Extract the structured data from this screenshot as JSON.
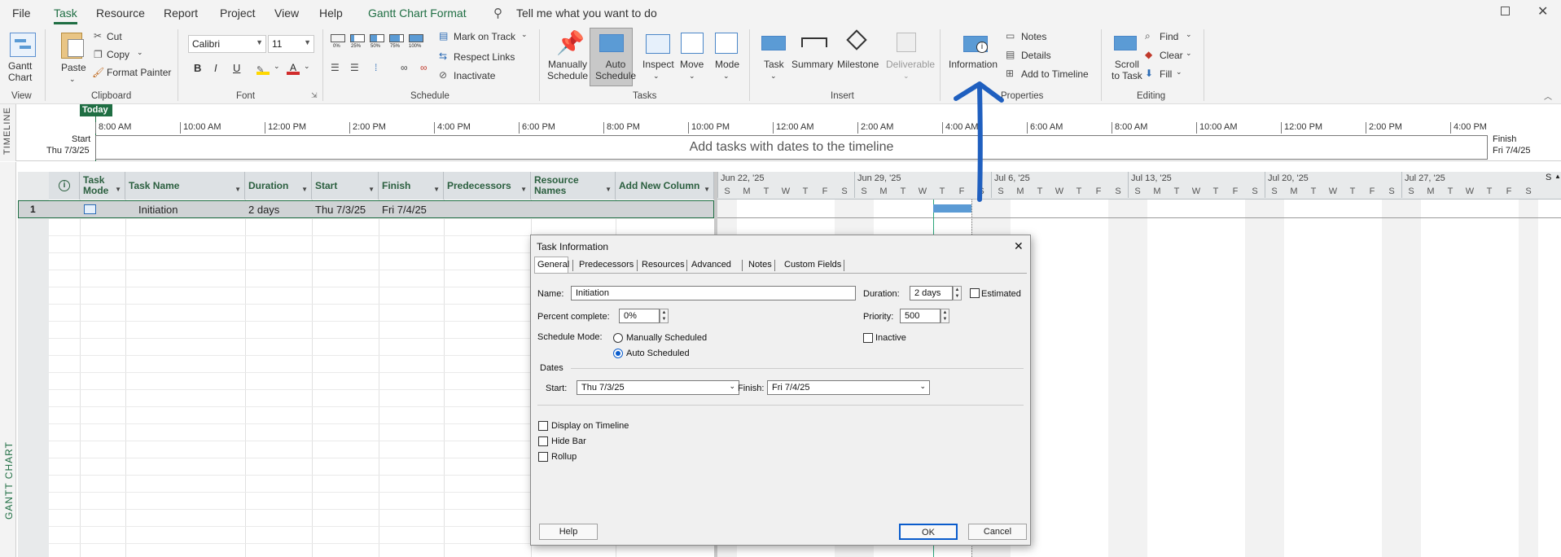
{
  "menu": {
    "file": "File",
    "task": "Task",
    "resource": "Resource",
    "report": "Report",
    "project": "Project",
    "view": "View",
    "help": "Help",
    "format": "Gantt Chart Format",
    "tell": "Tell me what you want to do"
  },
  "ribbon": {
    "gantt_chart": "Gantt\nChart",
    "groups": {
      "view": "View",
      "clipboard": "Clipboard",
      "font": "Font",
      "schedule": "Schedule",
      "tasks": "Tasks",
      "insert": "Insert",
      "properties": "Properties",
      "editing": "Editing"
    },
    "paste": "Paste",
    "cut": "Cut",
    "copy": "Copy",
    "format_painter": "Format Painter",
    "font_name": "Calibri",
    "font_size": "11",
    "bold": "B",
    "italic": "I",
    "underline": "U",
    "pct": [
      "0%",
      "25%",
      "50%",
      "75%",
      "100%"
    ],
    "mark_on_track": "Mark on Track",
    "respect_links": "Respect Links",
    "inactivate": "Inactivate",
    "manually_schedule": "Manually\nSchedule",
    "auto_schedule": "Auto\nSchedule",
    "inspect": "Inspect",
    "move": "Move",
    "mode": "Mode",
    "task": "Task",
    "summary": "Summary",
    "milestone": "Milestone",
    "deliverable": "Deliverable",
    "information": "Information",
    "notes": "Notes",
    "details": "Details",
    "add_to_timeline": "Add to Timeline",
    "scroll_to_task": "Scroll\nto Task",
    "find": "Find",
    "clear": "Clear",
    "fill": "Fill"
  },
  "timeline": {
    "side": "TIMELINE",
    "today": "Today",
    "start_label": "Start",
    "start_date": "Thu 7/3/25",
    "finish_label": "Finish",
    "finish_date": "Fri 7/4/25",
    "placeholder": "Add tasks with dates to the timeline",
    "ticks": [
      "8:00 AM",
      "10:00 AM",
      "12:00 PM",
      "2:00 PM",
      "4:00 PM",
      "6:00 PM",
      "8:00 PM",
      "10:00 PM",
      "12:00 AM",
      "2:00 AM",
      "4:00 AM",
      "6:00 AM",
      "8:00 AM",
      "10:00 AM",
      "12:00 PM",
      "2:00 PM",
      "4:00 PM"
    ]
  },
  "grid": {
    "side": "GANTT CHART",
    "info_icon": "i",
    "headers": [
      "Task\nMode",
      "Task Name",
      "Duration",
      "Start",
      "Finish",
      "Predecessors",
      "Resource\nNames",
      "Add New Column"
    ],
    "row": {
      "id": "1",
      "name": "Initiation",
      "duration": "2 days",
      "start": "Thu 7/3/25",
      "finish": "Fri 7/4/25"
    }
  },
  "gantt": {
    "weeks": [
      "Jun 22, '25",
      "Jun 29, '25",
      "Jul 6, '25",
      "Jul 13, '25",
      "Jul 20, '25",
      "Jul 27, '25"
    ],
    "days": [
      "S",
      "M",
      "T",
      "W",
      "T",
      "F",
      "S"
    ]
  },
  "dialog": {
    "title": "Task Information",
    "close": "✕",
    "tabs": [
      "General",
      "Predecessors",
      "Resources",
      "Advanced",
      "Notes",
      "Custom Fields"
    ],
    "name_label": "Name:",
    "name_value": "Initiation",
    "duration_label": "Duration:",
    "duration_value": "2 days",
    "estimated": "Estimated",
    "pct_label": "Percent complete:",
    "pct_value": "0%",
    "priority_label": "Priority:",
    "priority_value": "500",
    "mode_label": "Schedule Mode:",
    "manual": "Manually Scheduled",
    "auto": "Auto Scheduled",
    "inactive": "Inactive",
    "dates": "Dates",
    "start_label": "Start:",
    "start_value": "Thu 7/3/25",
    "finish_label": "Finish:",
    "finish_value": "Fri 7/4/25",
    "display_timeline": "Display on Timeline",
    "hide_bar": "Hide Bar",
    "rollup": "Rollup",
    "help": "Help",
    "ok": "OK",
    "cancel": "Cancel"
  },
  "colors": {
    "accent": "#1f6e43",
    "bar": "#5b9bd5",
    "arrow": "#1f5fbf"
  }
}
